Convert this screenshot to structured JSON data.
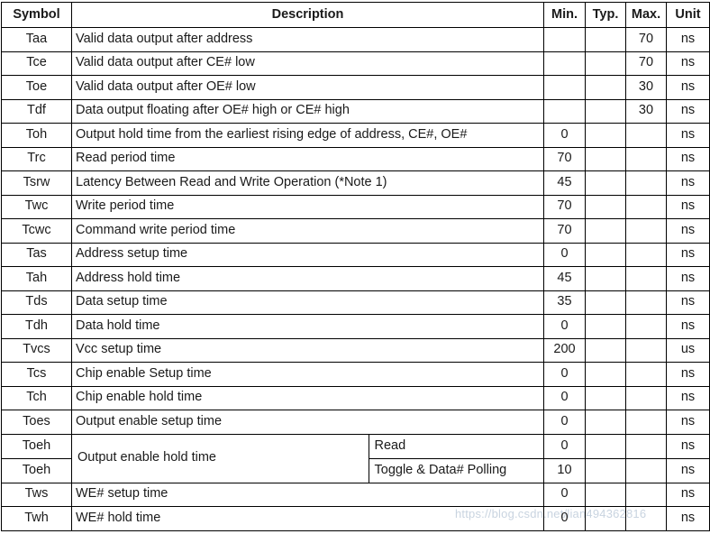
{
  "table": {
    "columns": [
      {
        "key": "symbol",
        "label": "Symbol"
      },
      {
        "key": "description",
        "label": "Description"
      },
      {
        "key": "min",
        "label": "Min."
      },
      {
        "key": "typ",
        "label": "Typ."
      },
      {
        "key": "max",
        "label": "Max."
      },
      {
        "key": "unit",
        "label": "Unit"
      }
    ],
    "rows": [
      {
        "symbol": "Taa",
        "description": "Valid data output after address",
        "min": "",
        "typ": "",
        "max": "70",
        "unit": "ns"
      },
      {
        "symbol": "Tce",
        "description": "Valid data output after CE# low",
        "min": "",
        "typ": "",
        "max": "70",
        "unit": "ns"
      },
      {
        "symbol": "Toe",
        "description": "Valid data output after OE# low",
        "min": "",
        "typ": "",
        "max": "30",
        "unit": "ns"
      },
      {
        "symbol": "Tdf",
        "description": "Data output floating after OE# high or CE# high",
        "min": "",
        "typ": "",
        "max": "30",
        "unit": "ns"
      },
      {
        "symbol": "Toh",
        "description": "Output hold time from the earliest rising edge of address, CE#, OE#",
        "min": "0",
        "typ": "",
        "max": "",
        "unit": "ns"
      },
      {
        "symbol": "Trc",
        "description": "Read period time",
        "min": "70",
        "typ": "",
        "max": "",
        "unit": "ns"
      },
      {
        "symbol": "Tsrw",
        "description": "Latency Between Read and Write Operation (*Note 1)",
        "min": "45",
        "typ": "",
        "max": "",
        "unit": "ns"
      },
      {
        "symbol": "Twc",
        "description": "Write period time",
        "min": "70",
        "typ": "",
        "max": "",
        "unit": "ns"
      },
      {
        "symbol": "Tcwc",
        "description": "Command write period time",
        "min": "70",
        "typ": "",
        "max": "",
        "unit": "ns"
      },
      {
        "symbol": "Tas",
        "description": "Address setup time",
        "min": "0",
        "typ": "",
        "max": "",
        "unit": "ns"
      },
      {
        "symbol": "Tah",
        "description": "Address hold time",
        "min": "45",
        "typ": "",
        "max": "",
        "unit": "ns"
      },
      {
        "symbol": "Tds",
        "description": "Data setup time",
        "min": "35",
        "typ": "",
        "max": "",
        "unit": "ns"
      },
      {
        "symbol": "Tdh",
        "description": "Data hold time",
        "min": "0",
        "typ": "",
        "max": "",
        "unit": "ns"
      },
      {
        "symbol": "Tvcs",
        "description": "Vcc setup time",
        "min": "200",
        "typ": "",
        "max": "",
        "unit": "us"
      },
      {
        "symbol": "Tcs",
        "description": "Chip enable Setup time",
        "min": "0",
        "typ": "",
        "max": "",
        "unit": "ns"
      },
      {
        "symbol": "Tch",
        "description": "Chip enable hold time",
        "min": "0",
        "typ": "",
        "max": "",
        "unit": "ns"
      },
      {
        "symbol": "Toes",
        "description": "Output enable setup time",
        "min": "0",
        "typ": "",
        "max": "",
        "unit": "ns"
      }
    ],
    "merged_group": {
      "description": "Output enable hold time",
      "sub_rows": [
        {
          "symbol": "Toeh",
          "condition": "Read",
          "min": "0",
          "typ": "",
          "max": "",
          "unit": "ns"
        },
        {
          "symbol": "Toeh",
          "condition": "Toggle & Data# Polling",
          "min": "10",
          "typ": "",
          "max": "",
          "unit": "ns"
        }
      ]
    },
    "trailing_rows": [
      {
        "symbol": "Tws",
        "description": "WE# setup time",
        "min": "0",
        "typ": "",
        "max": "",
        "unit": "ns"
      },
      {
        "symbol": "Twh",
        "description": "WE# hold time",
        "min": "0",
        "typ": "",
        "max": "",
        "unit": "ns"
      }
    ]
  },
  "watermark": {
    "text": "https://blog.csdn.net/lian494362816",
    "color": "#c9d4e0"
  }
}
